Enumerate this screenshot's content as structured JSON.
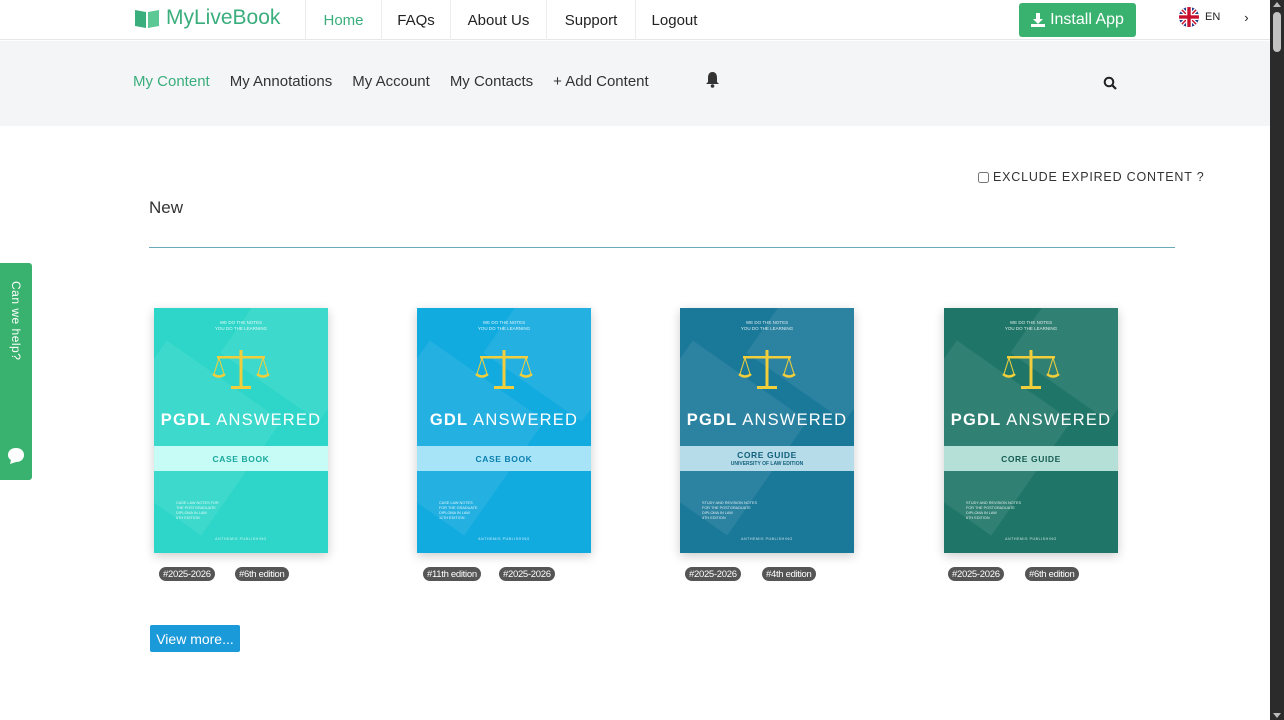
{
  "brand": {
    "name": "MyLiveBook",
    "color": "#3aae7c"
  },
  "topnav": [
    {
      "label": "Home",
      "active": true
    },
    {
      "label": "FAQs"
    },
    {
      "label": "About Us"
    },
    {
      "label": "Support"
    },
    {
      "label": "Logout"
    }
  ],
  "install_label": "Install App",
  "language": "EN",
  "subnav": [
    {
      "label": "My Content",
      "active": true
    },
    {
      "label": "My Annotations"
    },
    {
      "label": "My Account"
    },
    {
      "label": "My Contacts"
    },
    {
      "label": "+ Add Content"
    }
  ],
  "exclude_label": "EXCLUDE EXPIRED CONTENT ?",
  "section_title": "New",
  "books": [
    {
      "tagline1": "WE DO THE NOTES",
      "tagline2": "YOU DO THE LEARNING",
      "title_bold": "PGDL",
      "title_rest": "ANSWERED",
      "band1": "CASE BOOK",
      "band2": "",
      "notes": [
        "CASE LAW NOTES FOR",
        "THE POSTGRADUATE",
        "DIPLOMA IN LAW",
        "6TH EDITION"
      ],
      "publisher": "ANTHEMIS PUBLISHING",
      "cover_color": "#2dd6c8",
      "band_color": "#c6fbf6",
      "band_text": "#1aa89c",
      "tags": [
        "#2025-2026",
        "#6th edition"
      ]
    },
    {
      "tagline1": "WE DO THE NOTES",
      "tagline2": "YOU DO THE LEARNING",
      "title_bold": "GDL",
      "title_rest": "ANSWERED",
      "band1": "CASE BOOK",
      "band2": "",
      "notes": [
        "CASE LAW NOTES",
        "FOR THE GRADUATE",
        "DIPLOMA IN LAW",
        "11TH EDITION"
      ],
      "publisher": "ANTHEMIS PUBLISHING",
      "cover_color": "#12abe0",
      "band_color": "#a8e4f7",
      "band_text": "#0a7fb0",
      "tags": [
        "#11th edition",
        "#2025-2026"
      ]
    },
    {
      "tagline1": "WE DO THE NOTES",
      "tagline2": "YOU DO THE LEARNING",
      "title_bold": "PGDL",
      "title_rest": "ANSWERED",
      "band1": "CORE GUIDE",
      "band2": "UNIVERSITY OF LAW EDITION",
      "notes": [
        "STUDY AND REVISION NOTES",
        "FOR THE POSTGRADUATE",
        "DIPLOMA IN LAW",
        "4TH EDITION"
      ],
      "publisher": "ANTHEMIS PUBLISHING",
      "cover_color": "#1a7899",
      "band_color": "#b6dcea",
      "band_text": "#115f7a",
      "tags": [
        "#2025-2026",
        "#4th edition"
      ]
    },
    {
      "tagline1": "WE DO THE NOTES",
      "tagline2": "YOU DO THE LEARNING",
      "title_bold": "PGDL",
      "title_rest": "ANSWERED",
      "band1": "CORE GUIDE",
      "band2": "",
      "notes": [
        "STUDY AND REVISION NOTES",
        "FOR THE POSTGRADUATE",
        "DIPLOMA IN LAW",
        "6TH EDITION"
      ],
      "publisher": "ANTHEMIS PUBLISHING",
      "cover_color": "#1f7668",
      "band_color": "#b4e0d8",
      "band_text": "#175c51",
      "tags": [
        "#2025-2026",
        "#6th edition"
      ]
    }
  ],
  "view_more_label": "View more...",
  "help_tab_label": "Can we help?",
  "icons": {
    "logo": "book-icon",
    "install": "download-icon",
    "language": "uk-flag-icon",
    "bell": "bell-icon",
    "search": "search-icon",
    "chat": "chat-bubble-icon"
  }
}
